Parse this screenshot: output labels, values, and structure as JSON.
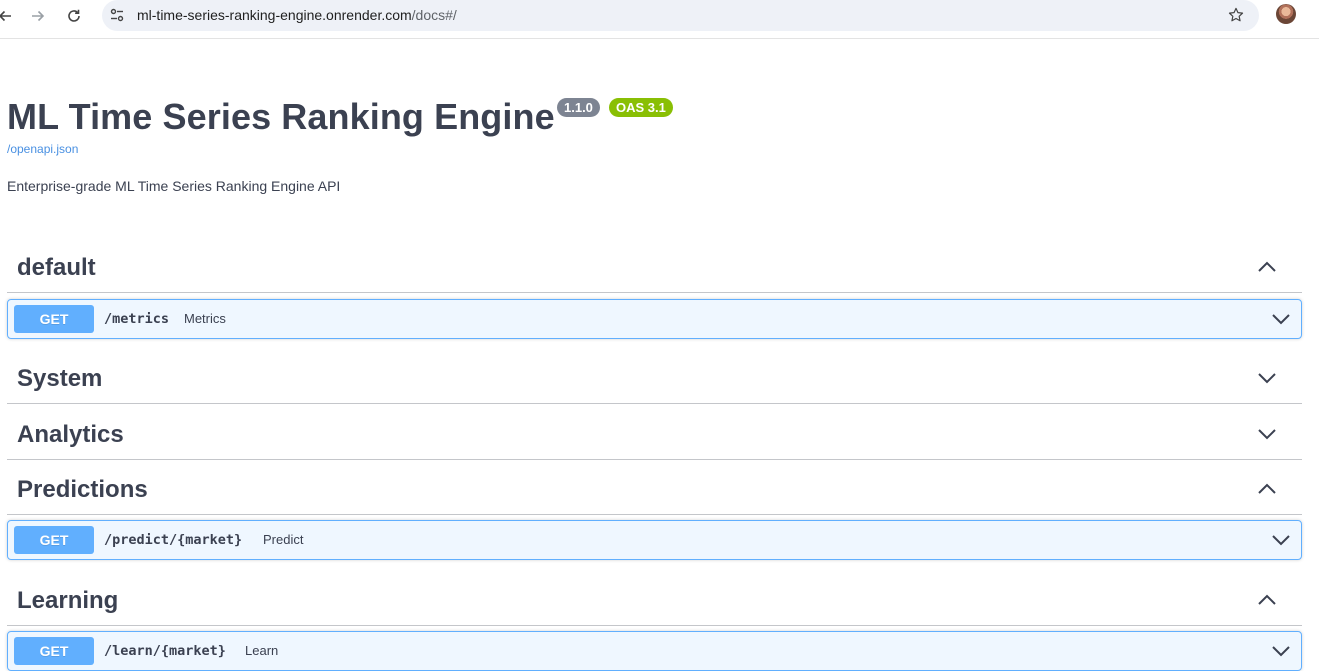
{
  "browser": {
    "url_host": "ml-time-series-ranking-engine.onrender.com",
    "url_path": "/docs#/"
  },
  "info": {
    "title": "ML Time Series Ranking Engine",
    "version": "1.1.0",
    "oas": "OAS 3.1",
    "spec_link": "/openapi.json",
    "description": "Enterprise-grade ML Time Series Ranking Engine API"
  },
  "tags": [
    {
      "name": "default",
      "expanded": true
    },
    {
      "name": "System",
      "expanded": false
    },
    {
      "name": "Analytics",
      "expanded": false
    },
    {
      "name": "Predictions",
      "expanded": true
    },
    {
      "name": "Learning",
      "expanded": true
    }
  ],
  "operations": [
    {
      "method": "GET",
      "path": "/metrics",
      "summary": "Metrics"
    },
    {
      "method": "GET",
      "path": "/predict/{market}",
      "summary": "Predict"
    },
    {
      "method": "GET",
      "path": "/learn/{market}",
      "summary": "Learn"
    }
  ],
  "colors": {
    "get_method": "#61affe",
    "version_badge": "#7d8492",
    "oas_badge": "#89bf04",
    "link": "#4990e2",
    "text": "#3b4151"
  },
  "icons": {
    "back": "arrow-left-icon",
    "forward": "arrow-right-icon",
    "reload": "reload-icon",
    "site_info": "tune-icon",
    "bookmark": "star-icon",
    "collapse": "chevron-up-icon",
    "expand": "chevron-down-icon"
  }
}
